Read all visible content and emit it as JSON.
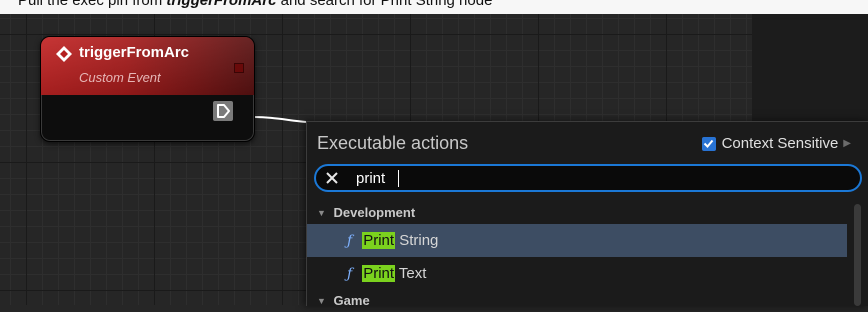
{
  "instruction": {
    "prefix": "Pull the exec pin from",
    "bold": "triggerFromArc",
    "suffix": "and search for Print String node"
  },
  "node": {
    "title": "triggerFromArc",
    "subtitle": "Custom Event",
    "icon": "event-diamond-icon",
    "header_color": "#c22424"
  },
  "menu": {
    "title": "Executable actions",
    "context_sensitive": {
      "label": "Context Sensitive",
      "checked": true
    },
    "search": {
      "value": "print",
      "placeholder": ""
    },
    "categories": [
      {
        "label": "Development",
        "items": [
          {
            "match": "Print",
            "rest": " String",
            "selected": true
          },
          {
            "match": "Print",
            "rest": " Text",
            "selected": false
          }
        ]
      },
      {
        "label": "Game"
      }
    ],
    "accent_color": "#1b78d6",
    "highlight_color": "#7bd21e"
  }
}
